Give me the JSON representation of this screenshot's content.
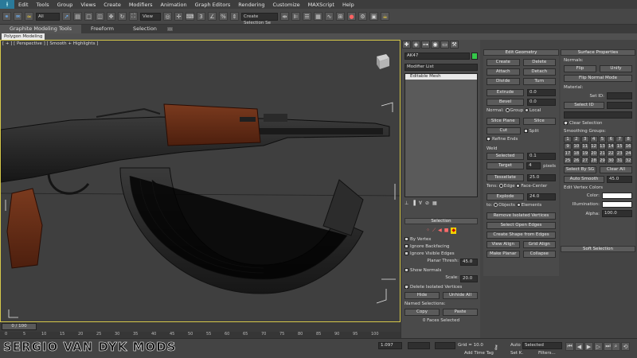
{
  "menu": [
    "Edit",
    "Tools",
    "Group",
    "Views",
    "Create",
    "Modifiers",
    "Animation",
    "Graph Editors",
    "Rendering",
    "Customize",
    "MAXScript",
    "Help"
  ],
  "toolbar": {
    "filter_select": "All",
    "view_select": "View",
    "selection_set": "Create Selection Se"
  },
  "ribbon": {
    "tabs": [
      "Graphite Modeling Tools",
      "Freeform",
      "Selection"
    ],
    "sub_label": "Polygon Modeling"
  },
  "viewport": {
    "label": "[ + ] [ Perspective ] [ Smooth + Highlights ]"
  },
  "command_panel": {
    "object_name": "AK47",
    "modifier_list": "Modifier List",
    "stack_item": "Editable Mesh",
    "selection": {
      "title": "Selection",
      "by_vertex": "By Vertex",
      "ignore_backfacing": "Ignore Backfacing",
      "ignore_visible_edges": "Ignore Visible Edges",
      "planar_thresh_label": "Planar Thresh:",
      "planar_thresh_value": "45.0",
      "show_normals": "Show Normals",
      "scale_label": "Scale:",
      "scale_value": "20.0",
      "delete_isolated": "Delete Isolated Vertices",
      "hide": "Hide",
      "unhide_all": "Unhide All",
      "named_selections": "Named Selections:",
      "copy": "Copy",
      "paste": "Paste",
      "status": "0 Faces Selected"
    }
  },
  "edit_geometry": {
    "title": "Edit Geometry",
    "create": "Create",
    "delete": "Delete",
    "attach": "Attach",
    "detach": "Detach",
    "divide": "Divide",
    "turn": "Turn",
    "extrude": "Extrude",
    "extrude_value": "0.0",
    "bevel": "Bevel",
    "bevel_value": "0.0",
    "normal_label": "Normal:",
    "group": "Group",
    "local": "Local",
    "slice_plane": "Slice Plane",
    "slice": "Slice",
    "cut": "Cut",
    "split": "Split",
    "refine_ends": "Refine Ends",
    "weld": "Weld",
    "selected": "Selected",
    "selected_value": "0.1",
    "target": "Target",
    "target_value": "4",
    "pixels": "pixels",
    "tessellate": "Tessellate",
    "tessellate_value": "25.0",
    "tension_label": "Tens:",
    "edge": "Edge",
    "face_center": "Face-Center",
    "explode": "Explode",
    "explode_value": "24.0",
    "to_label": "to:",
    "objects": "Objects",
    "elements": "Elements",
    "remove_isolated": "Remove Isolated Vertices",
    "select_open": "Select Open Edges",
    "create_shape": "Create Shape from Edges",
    "view_align": "View Align",
    "grid_align": "Grid Align",
    "make_planar": "Make Planar",
    "collapse": "Collapse"
  },
  "surface": {
    "title": "Surface Properties",
    "normals": "Normals:",
    "flip": "Flip",
    "unify": "Unify",
    "flip_normal_mode": "Flip Normal Mode",
    "material": "Material:",
    "set_id": "Set ID:",
    "select_id": "Select ID",
    "clear_selection": "Clear Selection",
    "smoothing_groups": "Smoothing Groups:",
    "sg": [
      "1",
      "2",
      "3",
      "4",
      "5",
      "6",
      "7",
      "8",
      "9",
      "10",
      "11",
      "12",
      "13",
      "14",
      "15",
      "16",
      "17",
      "18",
      "19",
      "20",
      "21",
      "22",
      "23",
      "24",
      "25",
      "26",
      "27",
      "28",
      "29",
      "30",
      "31",
      "32"
    ],
    "select_by_sg": "Select By SG",
    "clear_all": "Clear All",
    "auto_smooth": "Auto Smooth",
    "auto_smooth_value": "45.0",
    "edit_vertex_colors": "Edit Vertex Colors",
    "color": "Color:",
    "illumination": "Illumination:",
    "alpha": "Alpha:",
    "alpha_value": "100.0",
    "soft_selection": "Soft Selection"
  },
  "timeline": {
    "frame": "0 / 100",
    "ticks": [
      "0",
      "5",
      "10",
      "15",
      "20",
      "25",
      "30",
      "35",
      "40",
      "45",
      "50",
      "55",
      "60",
      "65",
      "70",
      "75",
      "80",
      "85",
      "90",
      "95",
      "100"
    ]
  },
  "status": {
    "watermark": "SERGIO VAN DYK MODS",
    "x_value": "1.097",
    "grid": "Grid = 10.0",
    "add_time_tag": "Add Time Tag",
    "auto": "Auto",
    "selected": "Selected",
    "set_k": "Set K.",
    "filters": "Filters..."
  },
  "colors": {
    "viewport_border": "#d6c84a",
    "stock_wood": "#6a2d17",
    "metal": "#262626"
  }
}
